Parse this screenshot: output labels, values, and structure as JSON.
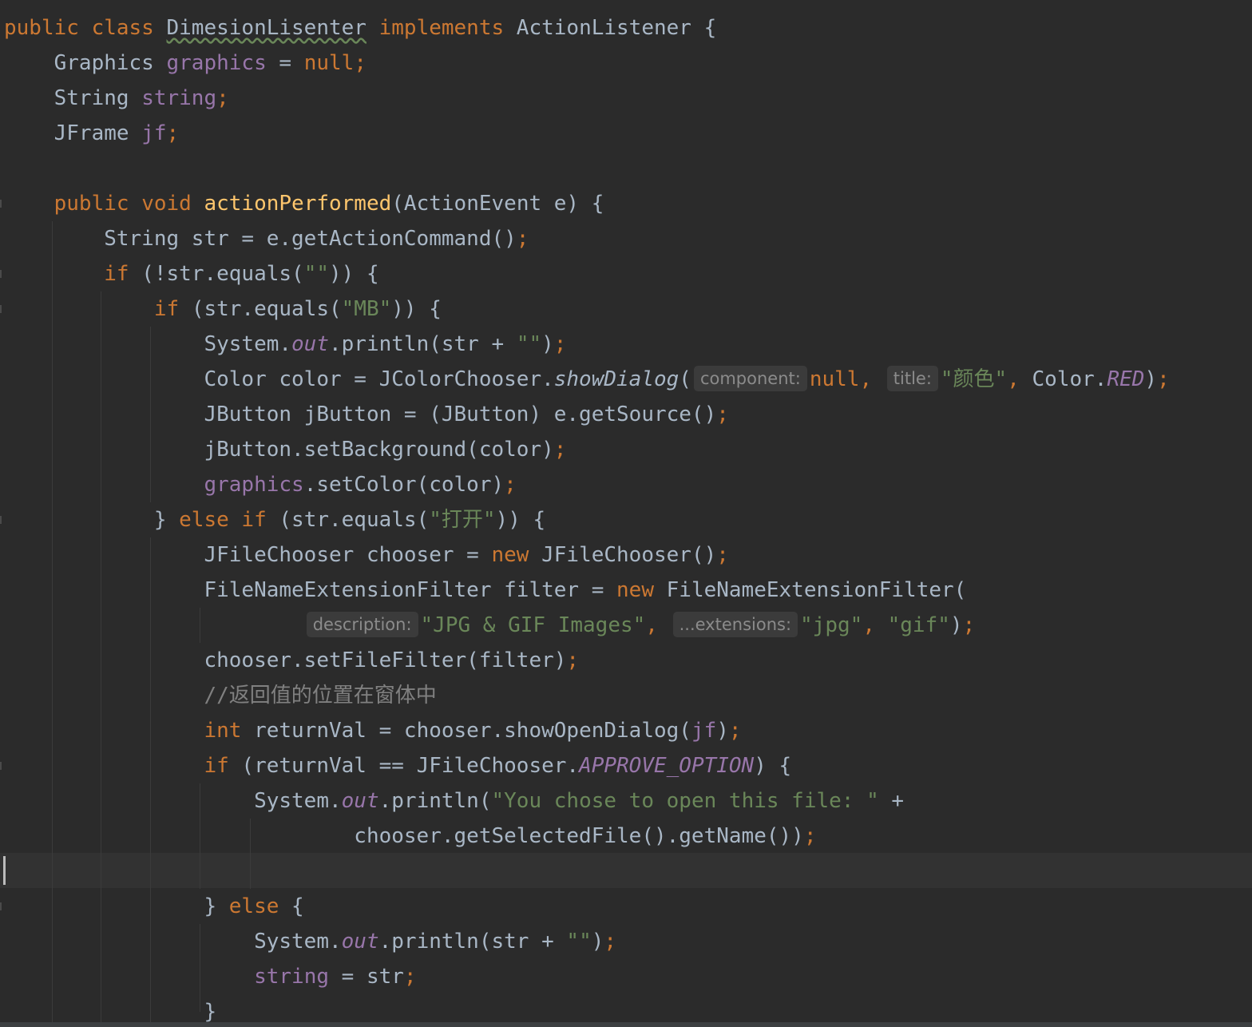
{
  "editor": {
    "language": "java",
    "theme": "darcula",
    "current_line_index": 24,
    "lines": [
      {
        "tokens": [
          {
            "t": "public class ",
            "c": "kw"
          },
          {
            "t": "DimesionLisenter",
            "c": "plain squiggle"
          },
          {
            "t": " implements ",
            "c": "kw"
          },
          {
            "t": "ActionListener {",
            "c": "plain"
          }
        ]
      },
      {
        "tokens": [
          {
            "t": "    Graphics ",
            "c": "plain"
          },
          {
            "t": "graphics",
            "c": "fld"
          },
          {
            "t": " = ",
            "c": "plain"
          },
          {
            "t": "null;",
            "c": "kw"
          }
        ]
      },
      {
        "tokens": [
          {
            "t": "    String ",
            "c": "plain"
          },
          {
            "t": "string",
            "c": "fld"
          },
          {
            "t": ";",
            "c": "kw"
          }
        ]
      },
      {
        "tokens": [
          {
            "t": "    JFrame ",
            "c": "plain"
          },
          {
            "t": "jf",
            "c": "fld"
          },
          {
            "t": ";",
            "c": "kw"
          }
        ]
      },
      {
        "tokens": []
      },
      {
        "tokens": [
          {
            "t": "    ",
            "c": "plain"
          },
          {
            "t": "public void ",
            "c": "kw"
          },
          {
            "t": "actionPerformed",
            "c": "fn"
          },
          {
            "t": "(ActionEvent e) {",
            "c": "plain"
          }
        ]
      },
      {
        "tokens": [
          {
            "t": "        String str = e.getActionCommand()",
            "c": "plain"
          },
          {
            "t": ";",
            "c": "kw"
          }
        ]
      },
      {
        "tokens": [
          {
            "t": "        ",
            "c": "plain"
          },
          {
            "t": "if ",
            "c": "kw"
          },
          {
            "t": "(!str.equals(",
            "c": "plain"
          },
          {
            "t": "\"\"",
            "c": "str"
          },
          {
            "t": ")) {",
            "c": "plain"
          }
        ]
      },
      {
        "tokens": [
          {
            "t": "            ",
            "c": "plain"
          },
          {
            "t": "if ",
            "c": "kw"
          },
          {
            "t": "(str.equals(",
            "c": "plain"
          },
          {
            "t": "\"MB\"",
            "c": "str"
          },
          {
            "t": ")) {",
            "c": "plain"
          }
        ]
      },
      {
        "tokens": [
          {
            "t": "                System.",
            "c": "plain"
          },
          {
            "t": "out",
            "c": "fldi"
          },
          {
            "t": ".println(str + ",
            "c": "plain"
          },
          {
            "t": "\"\"",
            "c": "str"
          },
          {
            "t": ")",
            "c": "plain"
          },
          {
            "t": ";",
            "c": "kw"
          }
        ]
      },
      {
        "tokens": [
          {
            "t": "                Color color = JColorChooser.",
            "c": "plain"
          },
          {
            "t": "showDialog",
            "c": "mi"
          },
          {
            "t": "(",
            "c": "plain"
          },
          {
            "t": "component:",
            "c": "hint"
          },
          {
            "t": "null, ",
            "c": "kw"
          },
          {
            "t": "title:",
            "c": "hint"
          },
          {
            "t": "\"颜色\"",
            "c": "str"
          },
          {
            "t": ", ",
            "c": "kw"
          },
          {
            "t": "Color.",
            "c": "plain"
          },
          {
            "t": "RED",
            "c": "fldi"
          },
          {
            "t": ")",
            "c": "plain"
          },
          {
            "t": ";",
            "c": "kw"
          }
        ]
      },
      {
        "tokens": [
          {
            "t": "                JButton jButton = (JButton) e.getSource()",
            "c": "plain"
          },
          {
            "t": ";",
            "c": "kw"
          }
        ]
      },
      {
        "tokens": [
          {
            "t": "                jButton.setBackground(color)",
            "c": "plain"
          },
          {
            "t": ";",
            "c": "kw"
          }
        ]
      },
      {
        "tokens": [
          {
            "t": "                ",
            "c": "plain"
          },
          {
            "t": "graphics",
            "c": "fld"
          },
          {
            "t": ".setColor(color)",
            "c": "plain"
          },
          {
            "t": ";",
            "c": "kw"
          }
        ]
      },
      {
        "tokens": [
          {
            "t": "            } ",
            "c": "plain"
          },
          {
            "t": "else if ",
            "c": "kw"
          },
          {
            "t": "(str.equals(",
            "c": "plain"
          },
          {
            "t": "\"打开\"",
            "c": "str"
          },
          {
            "t": ")) {",
            "c": "plain"
          }
        ]
      },
      {
        "tokens": [
          {
            "t": "                JFileChooser chooser = ",
            "c": "plain"
          },
          {
            "t": "new ",
            "c": "kw"
          },
          {
            "t": "JFileChooser()",
            "c": "plain"
          },
          {
            "t": ";",
            "c": "kw"
          }
        ]
      },
      {
        "tokens": [
          {
            "t": "                FileNameExtensionFilter filter = ",
            "c": "plain"
          },
          {
            "t": "new ",
            "c": "kw"
          },
          {
            "t": "FileNameExtensionFilter(",
            "c": "plain"
          }
        ]
      },
      {
        "tokens": [
          {
            "t": "                        ",
            "c": "plain"
          },
          {
            "t": "description:",
            "c": "hint"
          },
          {
            "t": "\"JPG & GIF Images\"",
            "c": "str"
          },
          {
            "t": ", ",
            "c": "kw"
          },
          {
            "t": "...extensions:",
            "c": "hint"
          },
          {
            "t": "\"jpg\"",
            "c": "str"
          },
          {
            "t": ", ",
            "c": "kw"
          },
          {
            "t": "\"gif\"",
            "c": "str"
          },
          {
            "t": ")",
            "c": "plain"
          },
          {
            "t": ";",
            "c": "kw"
          }
        ]
      },
      {
        "tokens": [
          {
            "t": "                chooser.setFileFilter(filter)",
            "c": "plain"
          },
          {
            "t": ";",
            "c": "kw"
          }
        ]
      },
      {
        "tokens": [
          {
            "t": "                //返回值的位置在窗体中",
            "c": "cmt"
          }
        ]
      },
      {
        "tokens": [
          {
            "t": "                ",
            "c": "plain"
          },
          {
            "t": "int ",
            "c": "kw"
          },
          {
            "t": "returnVal = chooser.showOpenDialog(",
            "c": "plain"
          },
          {
            "t": "jf",
            "c": "fld"
          },
          {
            "t": ")",
            "c": "plain"
          },
          {
            "t": ";",
            "c": "kw"
          }
        ]
      },
      {
        "tokens": [
          {
            "t": "                ",
            "c": "plain"
          },
          {
            "t": "if ",
            "c": "kw"
          },
          {
            "t": "(returnVal == JFileChooser.",
            "c": "plain"
          },
          {
            "t": "APPROVE_OPTION",
            "c": "fldi"
          },
          {
            "t": ") {",
            "c": "plain"
          }
        ]
      },
      {
        "tokens": [
          {
            "t": "                    System.",
            "c": "plain"
          },
          {
            "t": "out",
            "c": "fldi"
          },
          {
            "t": ".println(",
            "c": "plain"
          },
          {
            "t": "\"You chose to open this file: \"",
            "c": "str"
          },
          {
            "t": " +",
            "c": "plain"
          }
        ]
      },
      {
        "tokens": [
          {
            "t": "                            chooser.getSelectedFile().getName())",
            "c": "plain"
          },
          {
            "t": ";",
            "c": "kw"
          }
        ]
      },
      {
        "tokens": []
      },
      {
        "tokens": [
          {
            "t": "                } ",
            "c": "plain"
          },
          {
            "t": "else ",
            "c": "kw"
          },
          {
            "t": "{",
            "c": "plain"
          }
        ]
      },
      {
        "tokens": [
          {
            "t": "                    System.",
            "c": "plain"
          },
          {
            "t": "out",
            "c": "fldi"
          },
          {
            "t": ".println(str + ",
            "c": "plain"
          },
          {
            "t": "\"\"",
            "c": "str"
          },
          {
            "t": ")",
            "c": "plain"
          },
          {
            "t": ";",
            "c": "kw"
          }
        ]
      },
      {
        "tokens": [
          {
            "t": "                    ",
            "c": "plain"
          },
          {
            "t": "string",
            "c": "fld"
          },
          {
            "t": " = str",
            "c": "plain"
          },
          {
            "t": ";",
            "c": "kw"
          }
        ]
      },
      {
        "tokens": [
          {
            "t": "                }",
            "c": "plain"
          }
        ]
      }
    ]
  },
  "colors": {
    "background": "#2b2b2b",
    "current_line": "#323232",
    "plain": "#a9b7c6",
    "keyword": "#cc7832",
    "field": "#9876aa",
    "string": "#6a8759",
    "method_declaration": "#ffc66d",
    "comment": "#808080",
    "inlay_hint_bg": "#3b3b3b",
    "inlay_hint_fg": "#8b8b8b"
  }
}
